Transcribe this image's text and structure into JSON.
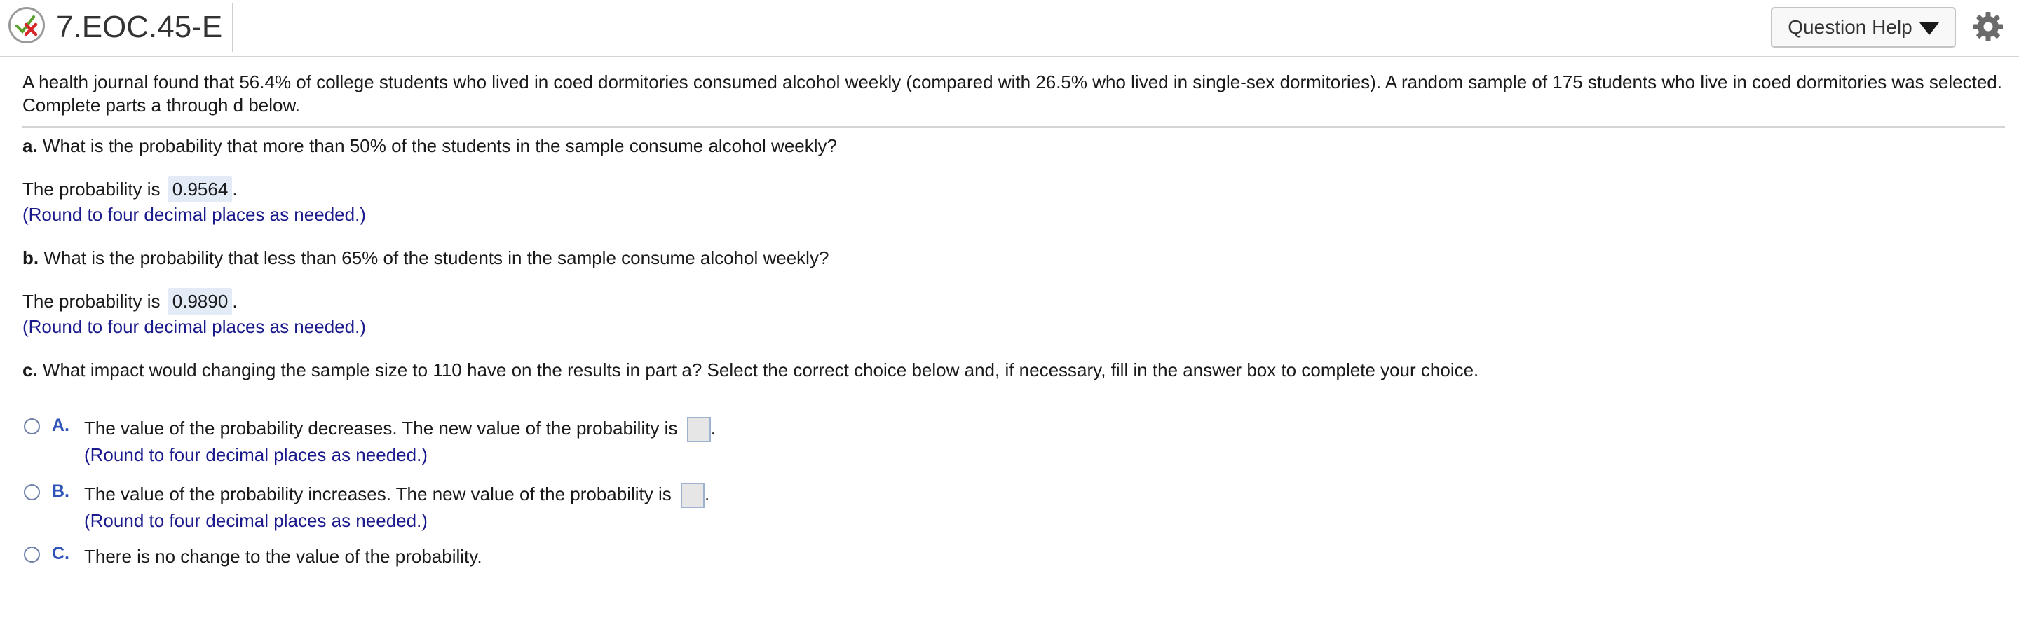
{
  "header": {
    "title": "7.EOC.45-E",
    "question_help_label": "Question Help",
    "icons": {
      "status": "partially-correct-status-icon",
      "help_caret": "caret-down-icon",
      "settings": "gear-icon"
    }
  },
  "problem_statement": "A health journal found that 56.4% of college students who lived in coed dormitories consumed alcohol weekly (compared with 26.5% who lived in single-sex dormitories). A random sample of 175 students who live in coed dormitories was selected. Complete parts a through d below.",
  "part_a": {
    "letter": "a.",
    "question": "What is the probability that more than 50% of the students in the sample consume alcohol weekly?",
    "answer_prefix": "The probability is",
    "answer_value": "0.9564",
    "answer_suffix": ".",
    "hint": "(Round to four decimal places as needed.)"
  },
  "part_b": {
    "letter": "b.",
    "question": "What is the probability that less than 65% of the students in the sample consume alcohol weekly?",
    "answer_prefix": "The probability is",
    "answer_value": "0.9890",
    "answer_suffix": ".",
    "hint": "(Round to four decimal places as needed.)"
  },
  "part_c": {
    "letter": "c.",
    "question": "What impact would changing the sample size to 110 have on the results in part a? Select the correct choice below and, if necessary, fill in the answer box to complete your choice.",
    "choices": [
      {
        "letter": "A.",
        "text": "The value of the probability decreases. The new value of the probability is",
        "suffix": ".",
        "hint": "(Round to four decimal places as needed.)",
        "selected": false
      },
      {
        "letter": "B.",
        "text": "The value of the probability increases. The new value of the probability is",
        "suffix": ".",
        "hint": "(Round to four decimal places as needed.)",
        "selected": false
      },
      {
        "letter": "C.",
        "text": "There is no change to the value of the probability.",
        "selected": false
      }
    ]
  },
  "colors": {
    "hint": "#1a1a8c",
    "choice_letter": "#2e53b8",
    "answer_box": "#e3ebf7"
  }
}
